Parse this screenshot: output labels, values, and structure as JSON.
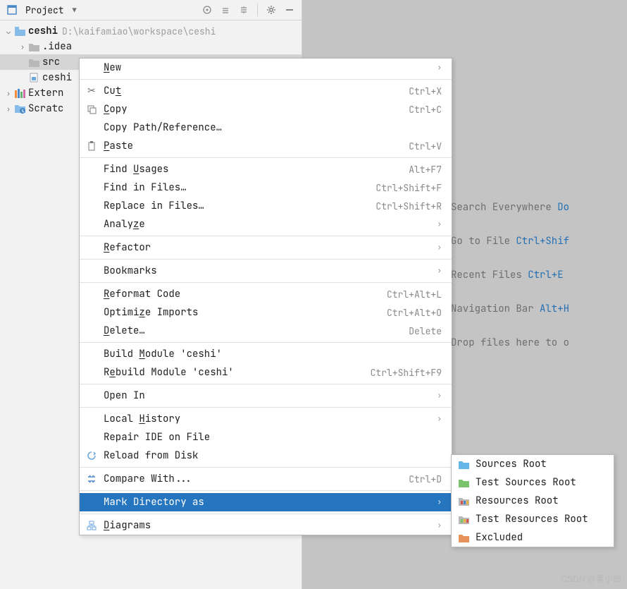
{
  "toolbar": {
    "title": "Project"
  },
  "tree": {
    "root": {
      "name": "ceshi",
      "path": "D:\\kaifamiao\\workspace\\ceshi"
    },
    "items": [
      {
        "name": ".idea"
      },
      {
        "name": "src"
      },
      {
        "name": "ceshi"
      },
      {
        "name": "Extern"
      },
      {
        "name": "Scratc"
      }
    ]
  },
  "menu": {
    "new": "New",
    "cut": "Cut",
    "cut_sc": "Ctrl+X",
    "copy": "Copy",
    "copy_sc": "Ctrl+C",
    "copy_path": "Copy Path/Reference…",
    "paste": "Paste",
    "paste_sc": "Ctrl+V",
    "find_usages": "Find Usages",
    "find_usages_sc": "Alt+F7",
    "find_in_files": "Find in Files…",
    "find_in_files_sc": "Ctrl+Shift+F",
    "replace_in_files": "Replace in Files…",
    "replace_in_files_sc": "Ctrl+Shift+R",
    "analyze": "Analyze",
    "refactor": "Refactor",
    "bookmarks": "Bookmarks",
    "reformat": "Reformat Code",
    "reformat_sc": "Ctrl+Alt+L",
    "optimize": "Optimize Imports",
    "optimize_sc": "Ctrl+Alt+O",
    "delete": "Delete…",
    "delete_sc": "Delete",
    "build": "Build Module 'ceshi'",
    "rebuild": "Rebuild Module 'ceshi'",
    "rebuild_sc": "Ctrl+Shift+F9",
    "open_in": "Open In",
    "local_history": "Local History",
    "repair": "Repair IDE on File",
    "reload": "Reload from Disk",
    "compare": "Compare With...",
    "compare_sc": "Ctrl+D",
    "mark_dir": "Mark Directory as",
    "diagrams": "Diagrams"
  },
  "submenu": {
    "sources": "Sources Root",
    "test_sources": "Test Sources Root",
    "resources": "Resources Root",
    "test_resources": "Test Resources Root",
    "excluded": "Excluded"
  },
  "welcome": {
    "l1a": "Search Everywhere ",
    "l1b": "Do",
    "l2a": "Go to File ",
    "l2b": "Ctrl+Shif",
    "l3a": "Recent Files ",
    "l3b": "Ctrl+E",
    "l4a": "Navigation Bar ",
    "l4b": "Alt+H",
    "l5": "Drop files here to o"
  },
  "watermark": "CSDN @茗小郎"
}
